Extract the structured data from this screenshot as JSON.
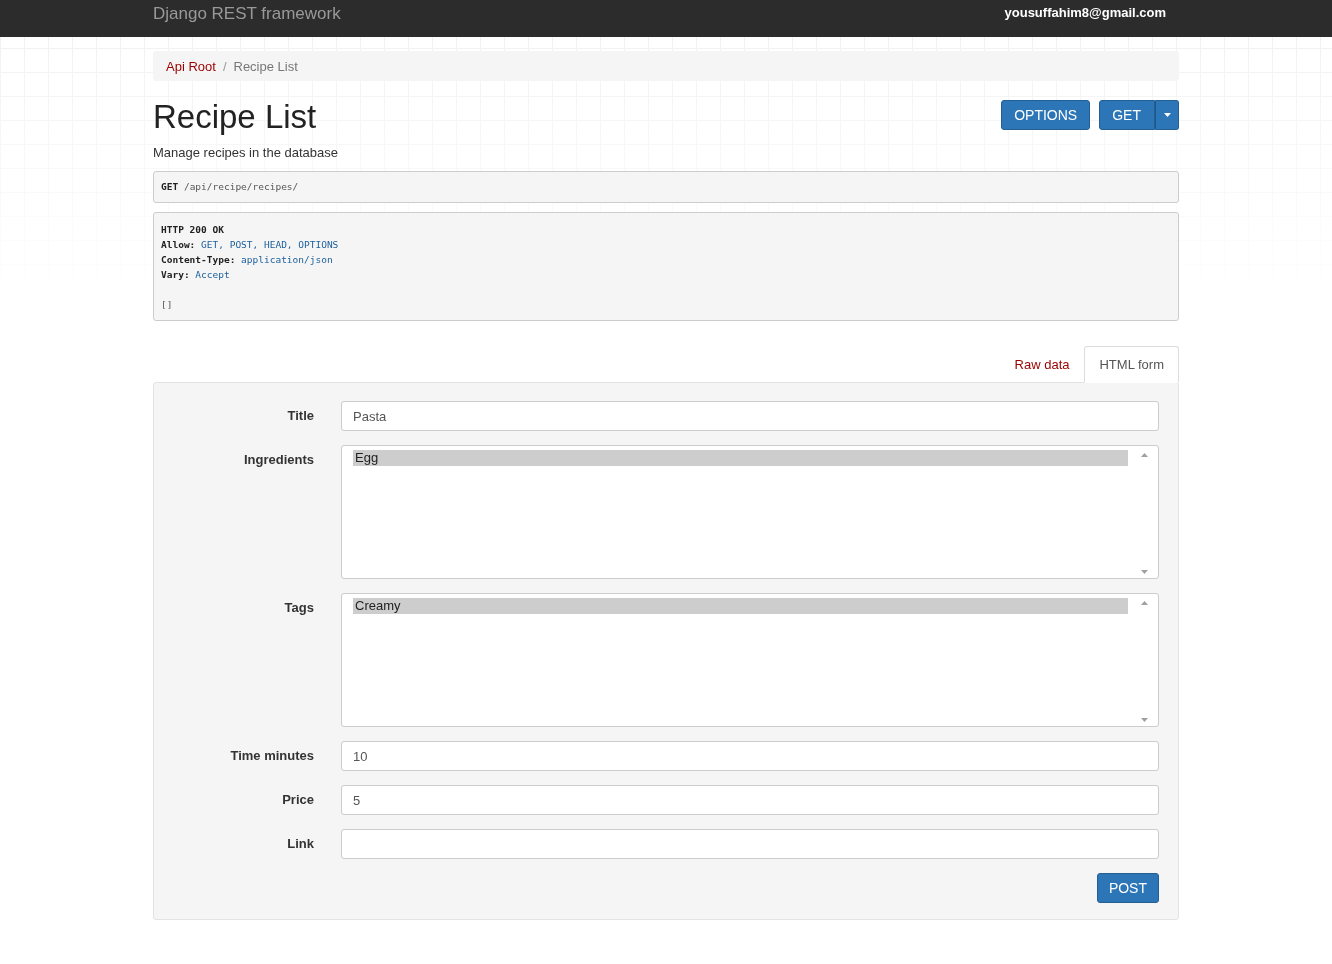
{
  "navbar": {
    "brand": "Django REST framework",
    "user": "yousuffahim8@gmail.com"
  },
  "breadcrumb": {
    "separator": "/",
    "items": [
      {
        "label": "Api Root",
        "selected": false
      },
      {
        "label": "Recipe List",
        "selected": true
      }
    ]
  },
  "page": {
    "title": "Recipe List",
    "description": "Manage recipes in the database",
    "buttons": [
      {
        "label": "OPTIONS",
        "kind": "plain"
      },
      {
        "label": "GET",
        "kind": "split"
      }
    ]
  },
  "request": {
    "method": "GET",
    "path": "/api/recipe/recipes/"
  },
  "response": {
    "status": "HTTP 200 OK",
    "headers": [
      {
        "name": "Allow:",
        "value": "GET, POST, HEAD, OPTIONS"
      },
      {
        "name": "Content-Type:",
        "value": "application/json"
      },
      {
        "name": "Vary:",
        "value": "Accept"
      }
    ],
    "body": "[]"
  },
  "tabs": [
    {
      "label": "Raw data",
      "selected": false
    },
    {
      "label": "HTML form",
      "selected": true
    }
  ],
  "form": {
    "fields": [
      {
        "kind": "text",
        "label": "Title",
        "value": "Pasta"
      },
      {
        "kind": "multiselect",
        "label": "Ingredients",
        "options": [
          {
            "label": "Egg",
            "selected": true
          }
        ]
      },
      {
        "kind": "multiselect",
        "label": "Tags",
        "options": [
          {
            "label": "Creamy",
            "selected": true
          }
        ]
      },
      {
        "kind": "text",
        "label": "Time minutes",
        "value": "10"
      },
      {
        "kind": "text",
        "label": "Price",
        "value": "5"
      },
      {
        "kind": "text",
        "label": "Link"
      }
    ],
    "submit": "POST"
  }
}
